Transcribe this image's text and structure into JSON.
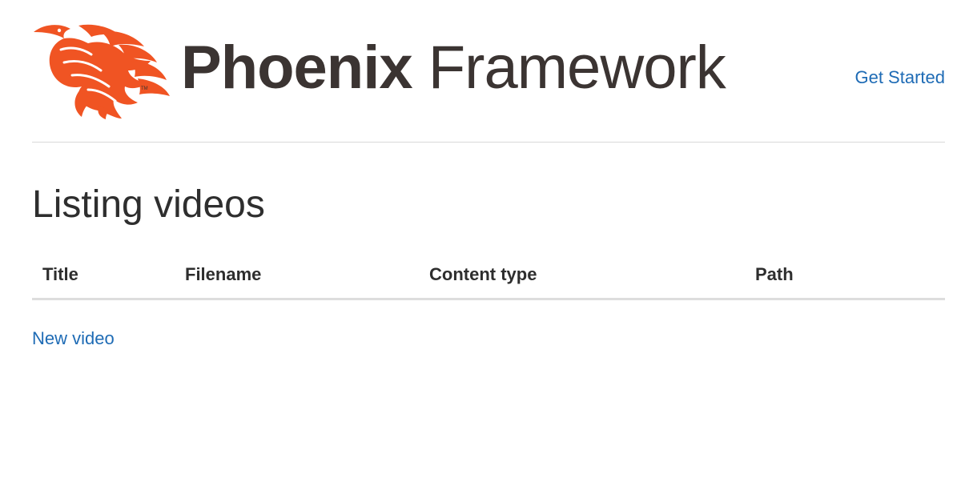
{
  "header": {
    "logo": {
      "brand_bold": "Phoenix",
      "brand_light": "Framework",
      "tm": "TM",
      "icon": "phoenix-bird-icon",
      "color": "#f05423"
    },
    "nav": {
      "get_started_label": "Get Started"
    }
  },
  "main": {
    "title": "Listing videos",
    "table": {
      "columns": [
        "Title",
        "Filename",
        "Content type",
        "Path"
      ],
      "rows": []
    },
    "new_video_label": "New video"
  },
  "colors": {
    "link": "#1e6bb5",
    "text": "#333333",
    "logo_text": "#3b3432",
    "divider": "#d9d9d9"
  }
}
